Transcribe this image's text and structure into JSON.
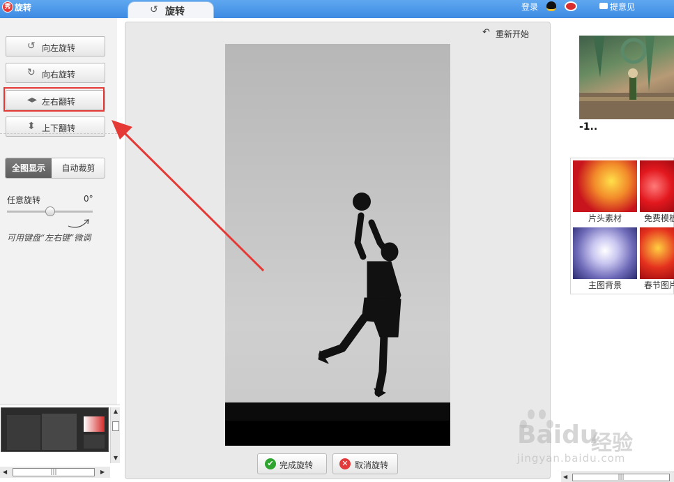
{
  "topbar": {
    "app_logo_text": "秀",
    "app_title": "旋转",
    "tab_label": "旋转",
    "login": "登录",
    "feedback": "提意见"
  },
  "left": {
    "rotate_left": "向左旋转",
    "rotate_right": "向右旋转",
    "flip_horizontal": "左右翻转",
    "flip_vertical": "上下翻转",
    "show_full": "全图显示",
    "auto_crop": "自动裁剪",
    "free_rotate_label": "任意旋转",
    "free_rotate_value": "0°",
    "hint": "可用键盘“左右键”微调",
    "free_rotate_slider": 0.5
  },
  "canvas": {
    "restart": "重新开始",
    "finish": "完成旋转",
    "cancel": "取消旋转"
  },
  "right": {
    "featured_title": "-1..",
    "tiles": [
      {
        "label": "片头素材"
      },
      {
        "label": "免费模板"
      },
      {
        "label": "主图背景"
      },
      {
        "label": "春节图片"
      }
    ]
  },
  "scrollbar": {
    "grip": "|||"
  },
  "watermark": {
    "brand": "Baidu",
    "cn": "经验",
    "url": "jingyan.baidu.com"
  },
  "colors": {
    "topbar": "#3d8ae3",
    "highlight": "#e53935",
    "arrow": "#e53935",
    "finish_icon": "#2fa52f",
    "cancel_icon": "#e23a3a"
  }
}
